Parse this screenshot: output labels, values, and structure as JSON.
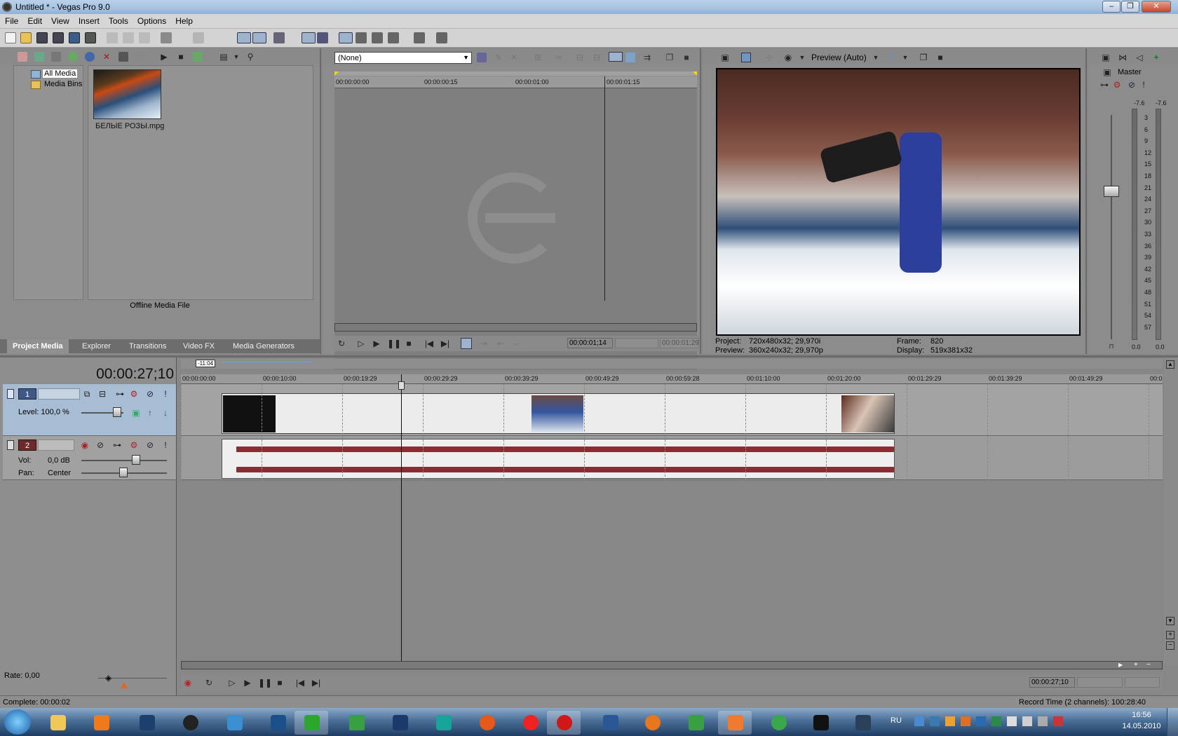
{
  "window": {
    "title": "Untitled * - Vegas Pro 9.0"
  },
  "menu": [
    "File",
    "Edit",
    "View",
    "Insert",
    "Tools",
    "Options",
    "Help"
  ],
  "explorer": {
    "tree": [
      "All Media",
      "Media Bins"
    ],
    "media_file": "БЕЛЫЕ РОЗЫ.mpg",
    "status": "Offline Media File",
    "tabs": [
      "Project Media",
      "Explorer",
      "Transitions",
      "Video FX",
      "Media Generators"
    ]
  },
  "trimmer": {
    "dropdown": "(None)",
    "ruler": [
      "00:00:00:00",
      "00:00:00:15",
      "00:00:01:00",
      "00:00:01:15"
    ],
    "time": "00:00:01;14",
    "time2": "00:00:01;29"
  },
  "preview": {
    "mode": "Preview (Auto)",
    "project_label": "Project:",
    "project_value": "720x480x32; 29,970i",
    "preview_label": "Preview:",
    "preview_value": "360x240x32; 29,970p",
    "frame_label": "Frame:",
    "frame_value": "820",
    "display_label": "Display:",
    "display_value": "519x381x32"
  },
  "mixer": {
    "title": "Master",
    "peak_left": "-7.6",
    "peak_right": "-7.6",
    "scale": [
      "3",
      "6",
      "9",
      "12",
      "15",
      "18",
      "21",
      "24",
      "27",
      "30",
      "33",
      "36",
      "39",
      "42",
      "45",
      "48",
      "51",
      "54",
      "57"
    ],
    "bottom_left": "0.0",
    "bottom_right": "0.0"
  },
  "timeline": {
    "cursor_time": "00:00:27;10",
    "marker": "-11:04",
    "ruler": [
      "00:00:00:00",
      "00:00:10:00",
      "00:00:19:29",
      "00:00:29:29",
      "00:00:39:29",
      "00:00:49:29",
      "00:00:59:28",
      "00:01:10:00",
      "00:01:20:00",
      "00:01:29:29",
      "00:01:39:29",
      "00:01:49:29",
      "00:0"
    ],
    "tracks": [
      {
        "num": "1",
        "type": "video",
        "param_label": "Level: 100,0 %"
      },
      {
        "num": "2",
        "type": "audio",
        "vol_label": "Vol:",
        "vol_value": "0,0 dB",
        "pan_label": "Pan:",
        "pan_value": "Center"
      }
    ],
    "rate": "Rate: 0,00",
    "end_time": "00:00:27;10",
    "status": "Complete: 00:00:02",
    "record_time": "Record Time (2 channels): 100:28:40"
  },
  "taskbar": {
    "lang": "RU",
    "time": "16:56",
    "date": "14.05.2010"
  }
}
